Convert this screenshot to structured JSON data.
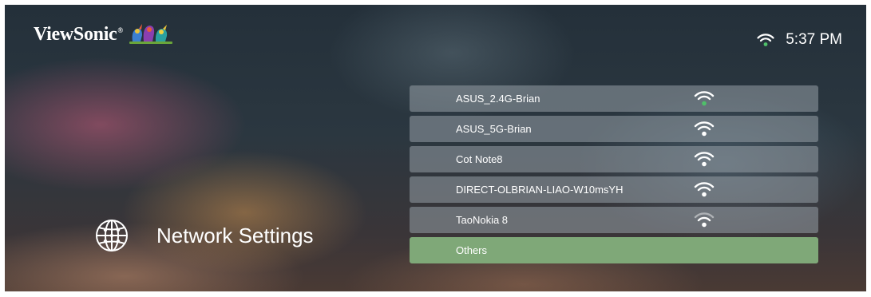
{
  "header": {
    "brand": "ViewSonic",
    "brand_reg": "®",
    "clock": "5:37 PM",
    "status_wifi_icon": "wifi-icon"
  },
  "page": {
    "title": "Network Settings",
    "icon": "globe-icon"
  },
  "networks": [
    {
      "ssid": "ASUS_2.4G-Brian",
      "icon": "wifi-icon",
      "connected": true
    },
    {
      "ssid": "ASUS_5G-Brian",
      "icon": "wifi-icon",
      "connected": false
    },
    {
      "ssid": "Cot Note8",
      "icon": "wifi-icon",
      "connected": false
    },
    {
      "ssid": "DIRECT-OLBRIAN-LIAO-W10msYH",
      "icon": "wifi-icon",
      "connected": false
    },
    {
      "ssid": "TaoNokia 8",
      "icon": "wifi-icon",
      "connected": false
    }
  ],
  "others_label": "Others",
  "colors": {
    "selected_row": "#7fa878",
    "row": "#969ea6",
    "wifi_connected": "#4fc06a",
    "wifi_default": "#ffffff"
  }
}
